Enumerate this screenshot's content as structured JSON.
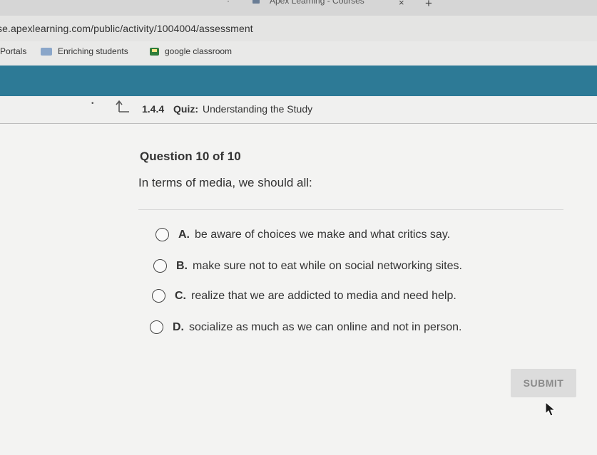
{
  "browser": {
    "tab_title": "Apex Learning - Courses",
    "tab_close": "×",
    "new_tab": "+",
    "url": "se.apexlearning.com/public/activity/1004004/assessment",
    "bookmarks": [
      {
        "label": "Portals",
        "icon": "none"
      },
      {
        "label": "Enriching students",
        "icon": "image-icon"
      },
      {
        "label": "google classroom",
        "icon": "classroom-icon"
      }
    ]
  },
  "quiz": {
    "id": "1.4.4",
    "label": "Quiz:",
    "title": "Understanding the Study",
    "back_icon": "back-arrow-icon"
  },
  "question": {
    "count": "Question 10 of 10",
    "text": "In terms of media, we should all:"
  },
  "options": [
    {
      "letter": "A.",
      "text": "be aware of choices we make and what critics say."
    },
    {
      "letter": "B.",
      "text": "make sure not to eat while on social networking sites."
    },
    {
      "letter": "C.",
      "text": "realize that we are addicted to media and need help."
    },
    {
      "letter": "D.",
      "text": "socialize as much as we can online and not in person."
    }
  ],
  "submit_label": "SUBMIT",
  "colors": {
    "header_band": "#2d7a96",
    "submit_bg": "#dcdcdc",
    "submit_text": "#8a8a8a"
  }
}
